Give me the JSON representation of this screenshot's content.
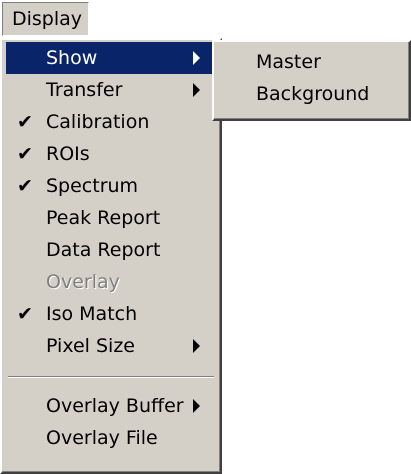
{
  "menubar": {
    "title": "Display"
  },
  "menu": {
    "items": [
      {
        "label": "Show",
        "checked": false,
        "submenu": true,
        "disabled": false,
        "selected": true
      },
      {
        "label": "Transfer",
        "checked": false,
        "submenu": true,
        "disabled": false,
        "selected": false
      },
      {
        "label": "Calibration",
        "checked": true,
        "submenu": false,
        "disabled": false,
        "selected": false
      },
      {
        "label": "ROIs",
        "checked": true,
        "submenu": false,
        "disabled": false,
        "selected": false
      },
      {
        "label": "Spectrum",
        "checked": true,
        "submenu": false,
        "disabled": false,
        "selected": false
      },
      {
        "label": "Peak Report",
        "checked": false,
        "submenu": false,
        "disabled": false,
        "selected": false
      },
      {
        "label": "Data Report",
        "checked": false,
        "submenu": false,
        "disabled": false,
        "selected": false
      },
      {
        "label": "Overlay",
        "checked": false,
        "submenu": false,
        "disabled": true,
        "selected": false
      },
      {
        "label": "Iso Match",
        "checked": true,
        "submenu": false,
        "disabled": false,
        "selected": false
      },
      {
        "label": "Pixel Size",
        "checked": false,
        "submenu": true,
        "disabled": false,
        "selected": false
      },
      {
        "label": "Overlay Buffer",
        "checked": false,
        "submenu": true,
        "disabled": false,
        "selected": false
      },
      {
        "label": "Overlay File",
        "checked": false,
        "submenu": false,
        "disabled": false,
        "selected": false
      }
    ],
    "check_glyph": "✔"
  },
  "submenu": {
    "items": [
      {
        "label": "Master"
      },
      {
        "label": "Background"
      }
    ]
  },
  "colors": {
    "menu_face": "#d4d0c8",
    "highlight": "#0a246a",
    "highlight_text": "#ffffff",
    "disabled_text": "#808080"
  }
}
